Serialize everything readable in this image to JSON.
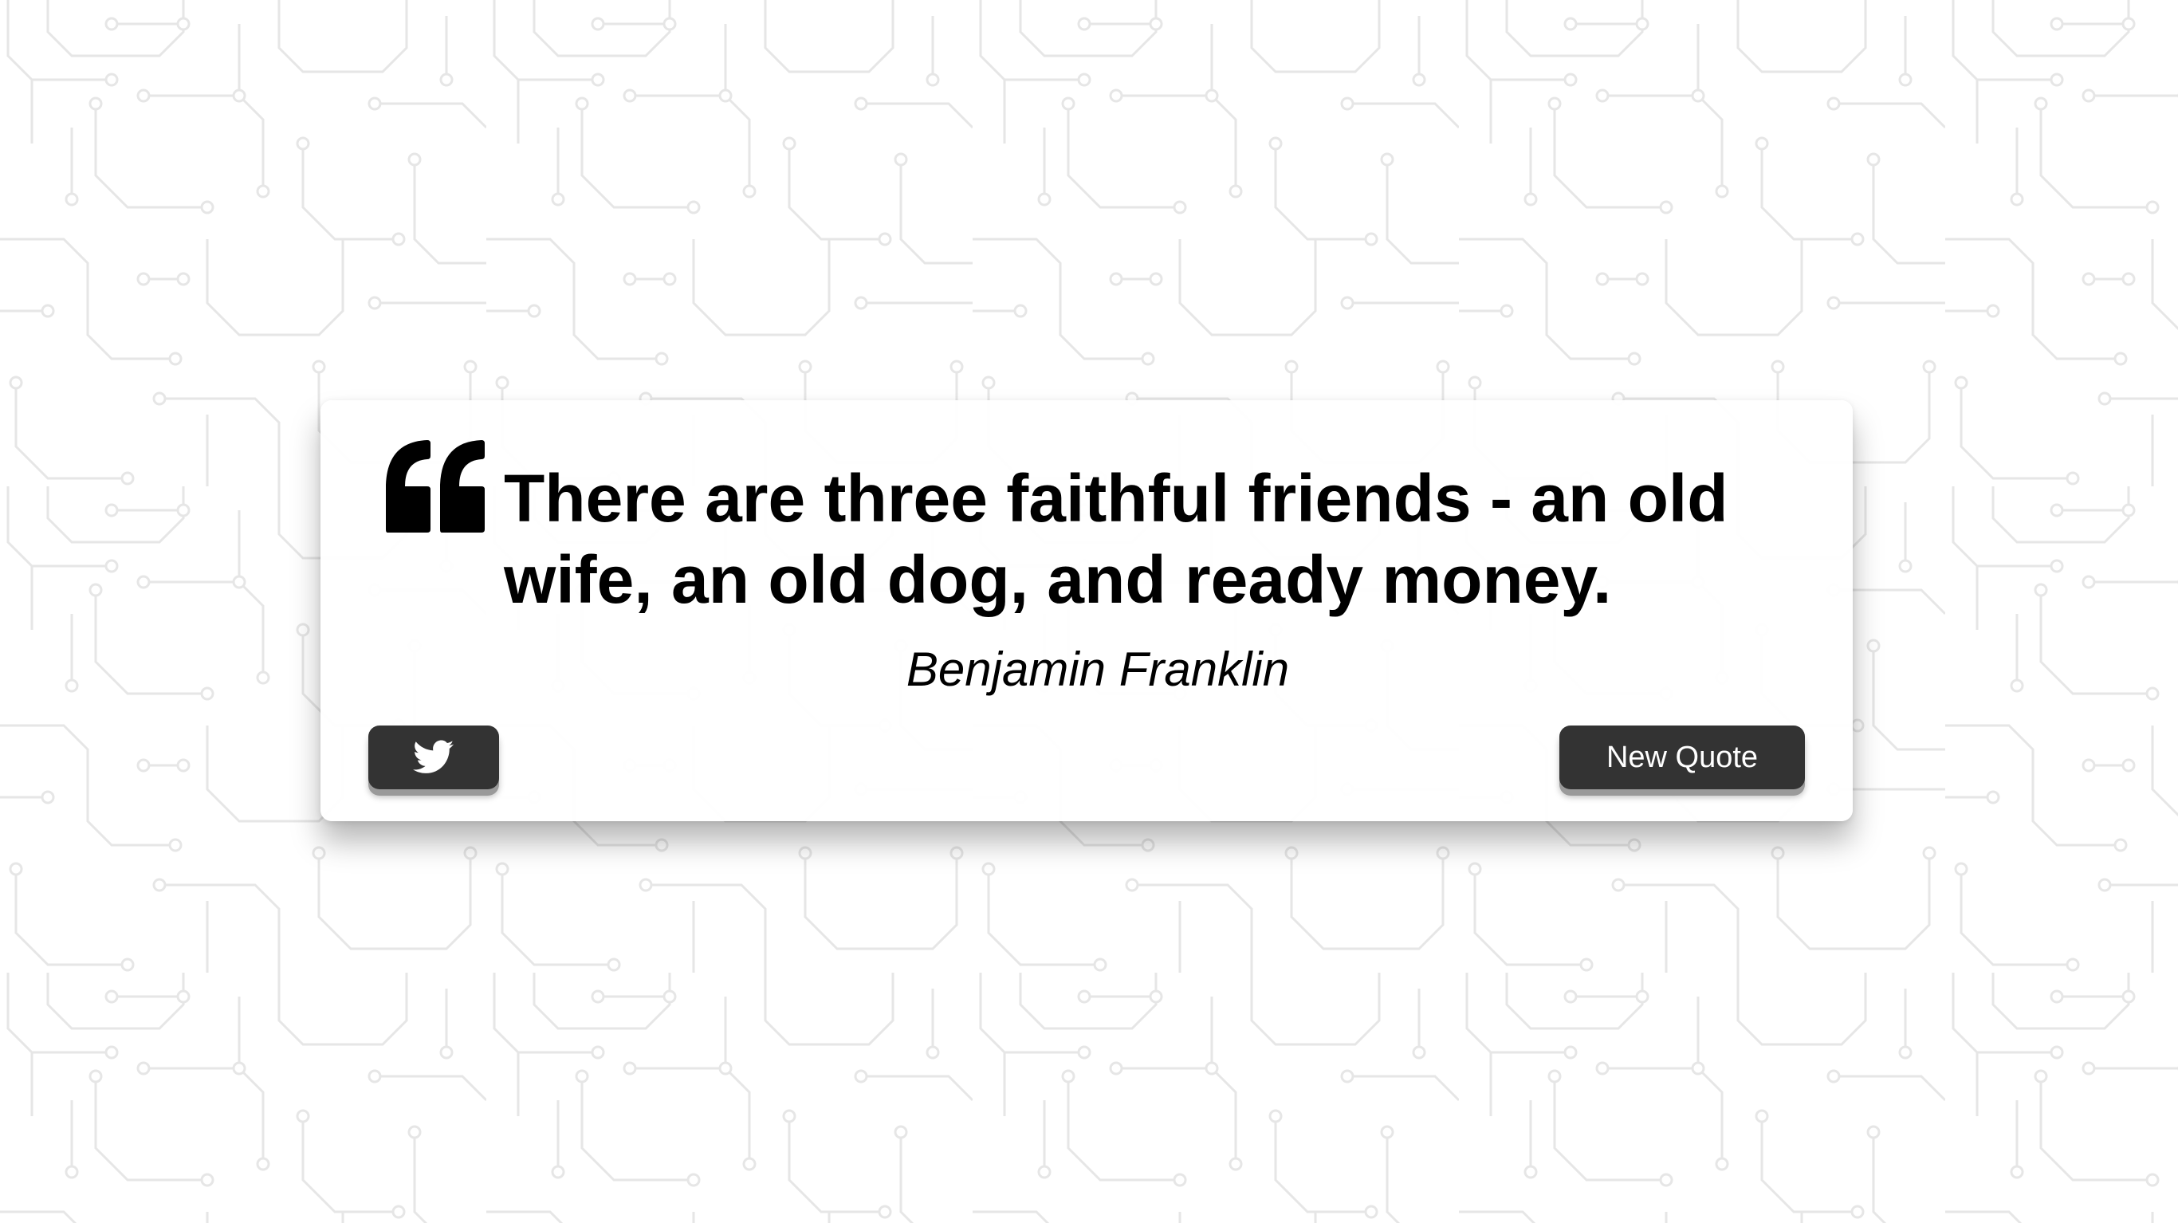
{
  "quote": {
    "text": "There are three faithful friends - an old wife, an old dog, and ready money.",
    "author": "Benjamin Franklin"
  },
  "buttons": {
    "tweet_icon": "twitter-icon",
    "new_quote_label": "New Quote"
  },
  "colors": {
    "button_bg": "#333333",
    "button_text": "#ffffff",
    "card_bg": "#ffffff",
    "background_pattern": "#e6e6e6",
    "text": "#000000"
  },
  "icons": {
    "quote_mark": "quote-left-icon",
    "tweet": "twitter-icon"
  }
}
